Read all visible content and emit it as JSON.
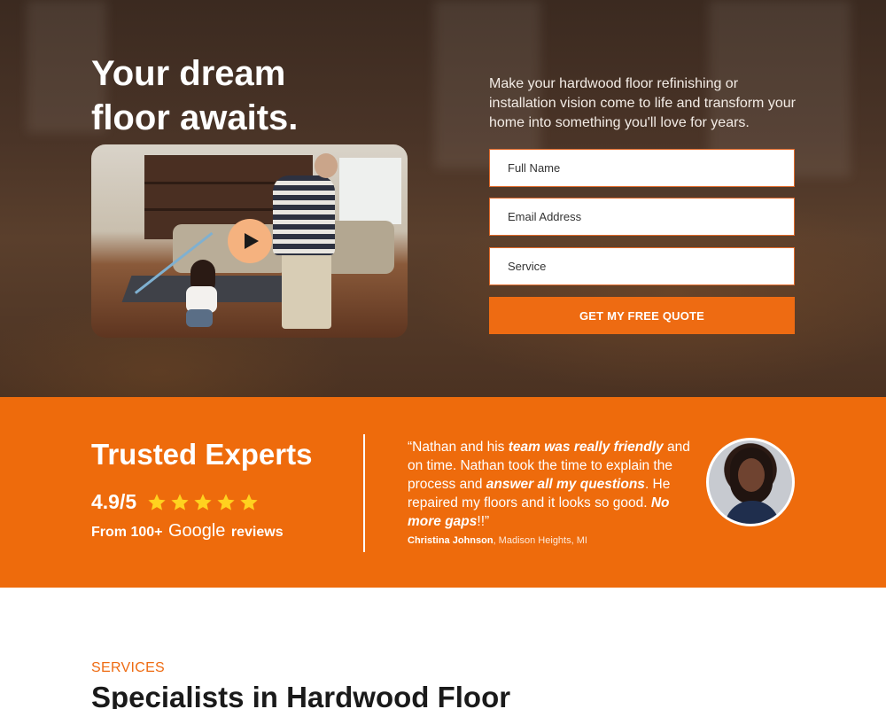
{
  "hero": {
    "title_line1": "Your dream",
    "title_line2": "floor awaits.",
    "description": "Make your hardwood floor refinishing or installation vision come to life and transform your home into something you'll love for years."
  },
  "form": {
    "full_name_placeholder": "Full Name",
    "email_placeholder": "Email Address",
    "service_placeholder": "Service",
    "submit_label": "GET MY FREE QUOTE"
  },
  "trust": {
    "title": "Trusted Experts",
    "rating": "4.9/5",
    "star_count": 5,
    "reviews_prefix": "From 100+",
    "reviews_brand": "Google",
    "reviews_suffix": "reviews"
  },
  "testimonial": {
    "q1": "“Nathan and his ",
    "q2": "team was really friendly",
    "q3": " and on time. Nathan took the time to explain the process and ",
    "q4": "answer all my questions",
    "q5": ". He repaired my floors and it looks so good. ",
    "q6": "No more gaps",
    "q7": "!!”",
    "author_name": "Christina Johnson",
    "author_location": ", Madison Heights, MI"
  },
  "services": {
    "kicker": "SERVICES",
    "title": "Specialists in Hardwood Floor"
  },
  "colors": {
    "accent": "#ee6b12",
    "star": "#ffd21f"
  },
  "icons": {
    "play": "play-icon",
    "star": "star-icon"
  }
}
